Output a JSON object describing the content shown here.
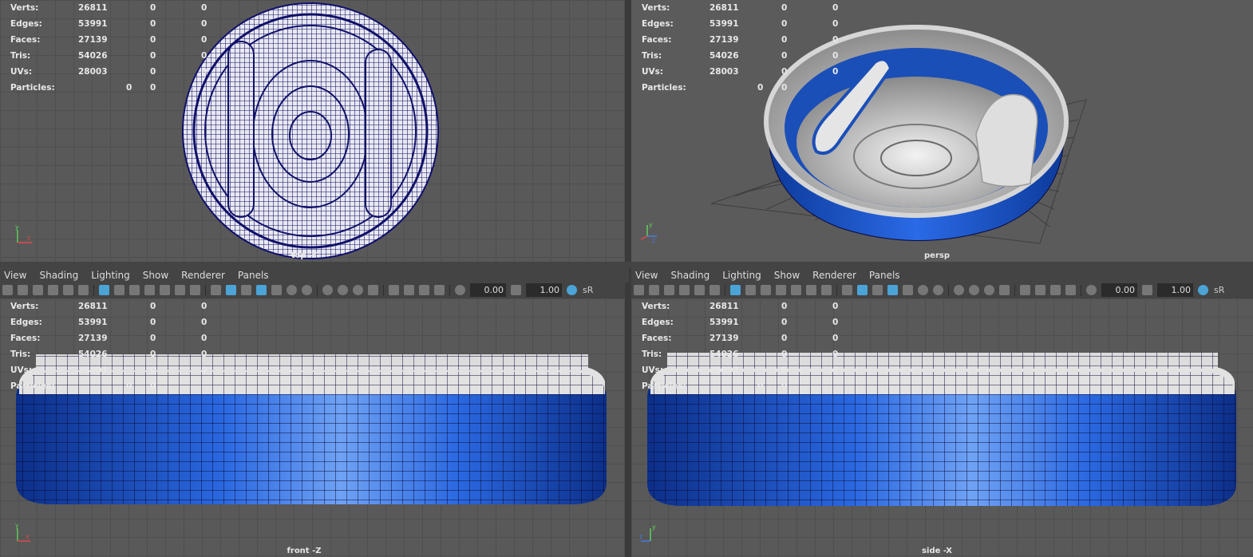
{
  "hud": {
    "rows": [
      {
        "label": "Verts:",
        "v1": "26811",
        "v2": "0",
        "v3": "0"
      },
      {
        "label": "Edges:",
        "v1": "53991",
        "v2": "0",
        "v3": "0"
      },
      {
        "label": "Faces:",
        "v1": "27139",
        "v2": "0",
        "v3": "0"
      },
      {
        "label": "Tris:",
        "v1": "54026",
        "v2": "0",
        "v3": "0"
      },
      {
        "label": "UVs:",
        "v1": "28003",
        "v2": "0",
        "v3": "0"
      }
    ],
    "particles": {
      "label": "Particles:",
      "v1": "0",
      "v2": "0"
    }
  },
  "viewports": {
    "top": {
      "label": "top -Y"
    },
    "persp": {
      "label": "persp"
    },
    "front": {
      "label": "front -Z"
    },
    "side": {
      "label": "side -X"
    }
  },
  "menu": {
    "view": "View",
    "shading": "Shading",
    "lighting": "Lighting",
    "show": "Show",
    "renderer": "Renderer",
    "panels": "Panels"
  },
  "toolbar": {
    "exposure": "0.00",
    "gamma": "1.00",
    "colorspace": "sR"
  },
  "colors": {
    "model_blue": "#1b56c8",
    "model_white": "#e6e6e6",
    "wire": "#0a0a55",
    "grid": "#595959"
  }
}
